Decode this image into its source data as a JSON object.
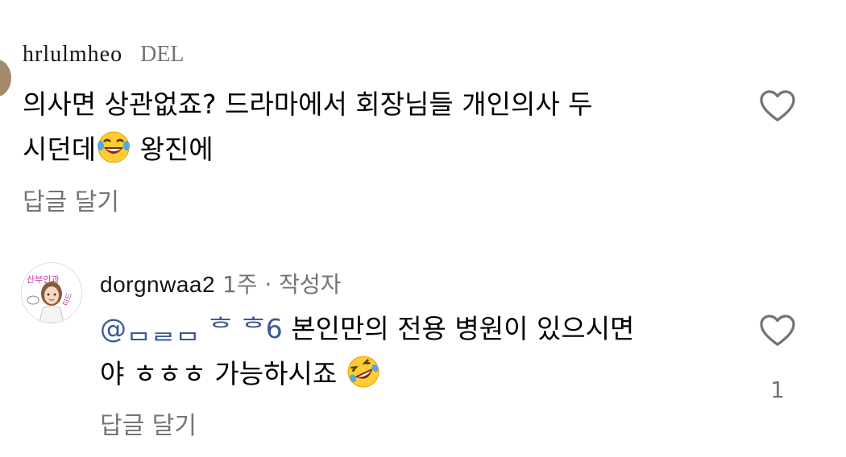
{
  "comments": [
    {
      "username": "hrlulmheo",
      "meta": "DEL",
      "text_line1": "의사면 상관없죠? 드라마에서 회장님들 개인의사 두",
      "text_line2_before": "시던데",
      "emoji": "laughing-with-tears-emoji",
      "text_line2_after": " 왕진에",
      "reply_label": "답글 달기",
      "like_icon": "heart-outline-icon"
    },
    {
      "username": "dorgnwaa2",
      "meta": " 1주 · 작성자",
      "avatar_text_top": "산부인과",
      "avatar_text_side": "미드",
      "mention": "@ᆷᆯᆷ ᄒ ᄒ6",
      "text_line1_after": " 본인만의 전용 병원이 있으시면",
      "text_line2_before": "야 ㅎㅎㅎ 가능하시죠 ",
      "emoji": "rolling-on-floor-laughing-emoji",
      "reply_label": "답글 달기",
      "like_icon": "heart-outline-icon",
      "like_count": "1"
    }
  ]
}
